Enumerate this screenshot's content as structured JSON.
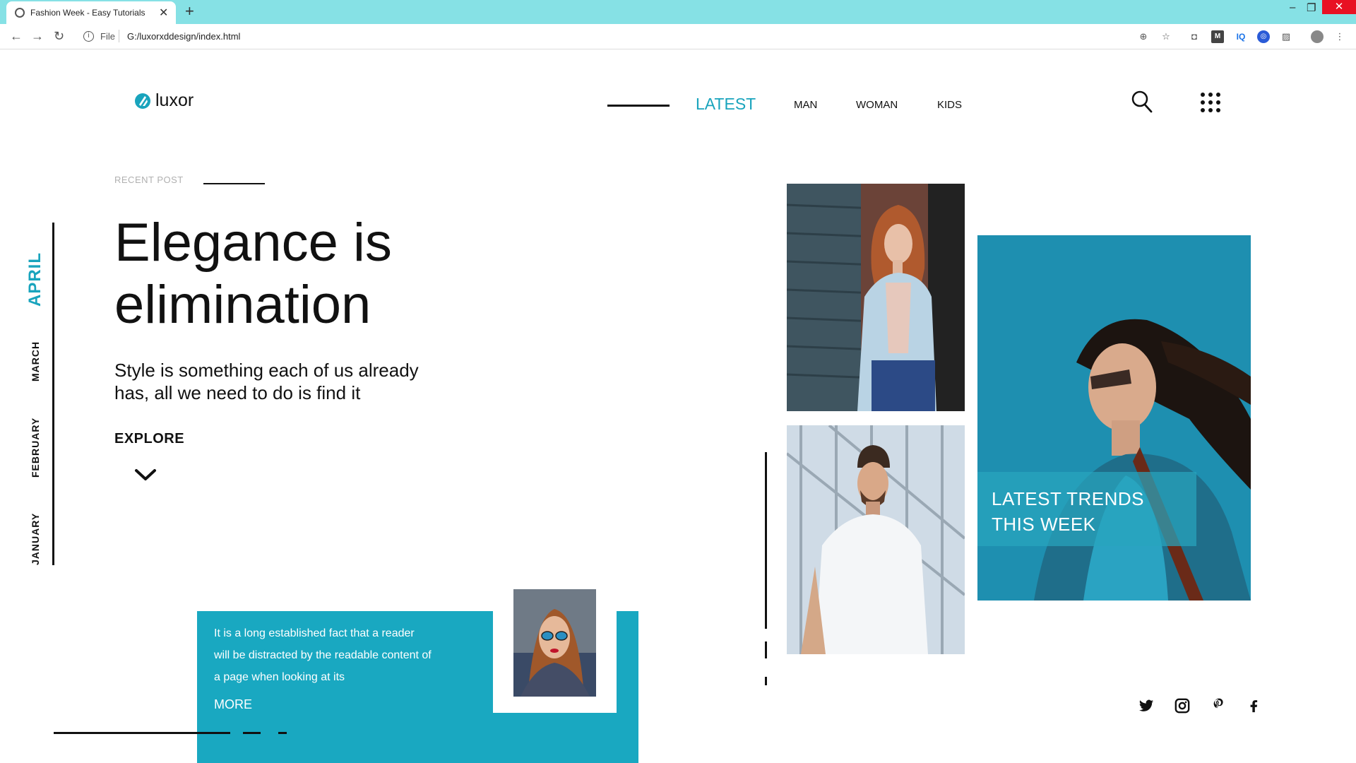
{
  "browser": {
    "tab_title": "Fashion Week - Easy Tutorials",
    "url_scheme": "File",
    "url": "G:/luxorxddesign/index.html"
  },
  "site": {
    "logo_text": "luxor",
    "nav": [
      {
        "label": "LATEST",
        "active": true
      },
      {
        "label": "MAN"
      },
      {
        "label": "WOMAN"
      },
      {
        "label": "KIDS"
      }
    ]
  },
  "hero": {
    "recent_label": "RECENT POST",
    "title_line1": "Elegance is",
    "title_line2": "elimination",
    "subtitle_line1": "Style is something each of us already",
    "subtitle_line2": "has, all we need to do is find it",
    "explore_label": "EXPLORE"
  },
  "months": [
    {
      "label": "APRIL",
      "active": true
    },
    {
      "label": "MARCH"
    },
    {
      "label": "FEBRUARY"
    },
    {
      "label": "JANUARY"
    }
  ],
  "card": {
    "line1": "It is a long established fact that a reader",
    "line2": "will be distracted by the readable content of",
    "line3": "a page when looking at its",
    "more_label": "MORE"
  },
  "gallery": {
    "trends_line1": "LATEST TRENDS",
    "trends_line2": "THIS WEEK"
  },
  "colors": {
    "accent": "#19a4bd",
    "tabbar": "#86e1e5"
  },
  "social_icons": [
    "twitter-icon",
    "instagram-icon",
    "pinterest-icon",
    "facebook-icon"
  ]
}
